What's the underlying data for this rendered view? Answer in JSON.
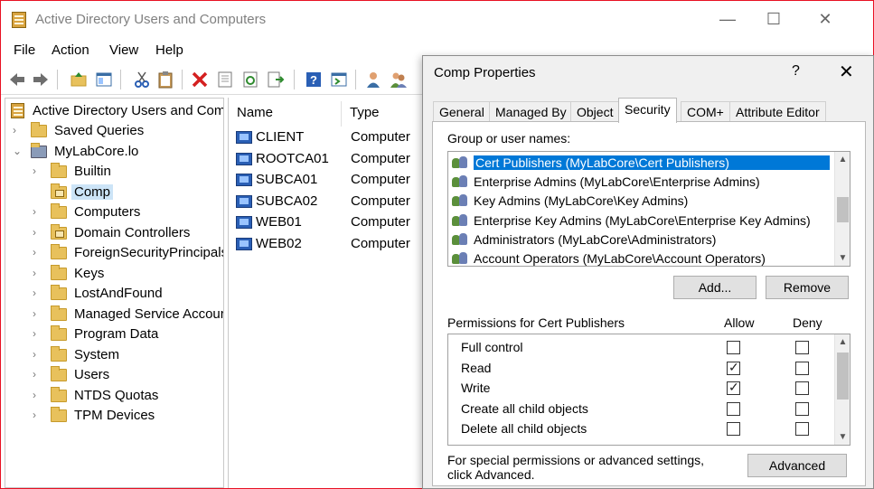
{
  "window": {
    "title": "Active Directory Users and Computers",
    "minimize": "—",
    "maximize": "☐",
    "close": "✕"
  },
  "menu": [
    "File",
    "Action",
    "View",
    "Help"
  ],
  "toolbar": {
    "icons": [
      "back-arrow-icon",
      "forward-arrow-icon",
      "up-folder-icon",
      "show-hide-tree-icon",
      "cut-icon",
      "clipboard-icon",
      "delete-icon",
      "properties-icon",
      "refresh-icon",
      "export-list-icon",
      "help-icon",
      "console-icon",
      "user-icon",
      "users-icon"
    ]
  },
  "tree": {
    "root": "Active Directory Users and Com",
    "items": [
      {
        "label": "Saved Queries",
        "level": 1,
        "expander": "›"
      },
      {
        "label": "MyLabCore.lo",
        "level": 1,
        "expander": "⌄"
      },
      {
        "label": "Builtin",
        "level": 2,
        "expander": "›"
      },
      {
        "label": "Comp",
        "level": 2,
        "expander": "",
        "selected": true
      },
      {
        "label": "Computers",
        "level": 2,
        "expander": "›"
      },
      {
        "label": "Domain Controllers",
        "level": 2,
        "expander": "›"
      },
      {
        "label": "ForeignSecurityPrincipals",
        "level": 2,
        "expander": "›"
      },
      {
        "label": "Keys",
        "level": 2,
        "expander": "›"
      },
      {
        "label": "LostAndFound",
        "level": 2,
        "expander": "›"
      },
      {
        "label": "Managed Service Accour",
        "level": 2,
        "expander": "›"
      },
      {
        "label": "Program Data",
        "level": 2,
        "expander": "›"
      },
      {
        "label": "System",
        "level": 2,
        "expander": "›"
      },
      {
        "label": "Users",
        "level": 2,
        "expander": "›"
      },
      {
        "label": "NTDS Quotas",
        "level": 2,
        "expander": "›"
      },
      {
        "label": "TPM Devices",
        "level": 2,
        "expander": "›"
      }
    ]
  },
  "list": {
    "columns": [
      "Name",
      "Type"
    ],
    "rows": [
      {
        "name": "CLIENT",
        "type": "Computer"
      },
      {
        "name": "ROOTCA01",
        "type": "Computer"
      },
      {
        "name": "SUBCA01",
        "type": "Computer"
      },
      {
        "name": "SUBCA02",
        "type": "Computer"
      },
      {
        "name": "WEB01",
        "type": "Computer"
      },
      {
        "name": "WEB02",
        "type": "Computer"
      }
    ]
  },
  "dialog": {
    "title": "Comp Properties",
    "help": "?",
    "close": "✕",
    "tabs": [
      "General",
      "Managed By",
      "Object",
      "Security",
      "COM+",
      "Attribute Editor"
    ],
    "active_tab": "Security",
    "group_label": "Group or user names:",
    "groups": [
      "Cert Publishers (MyLabCore\\Cert Publishers)",
      "Enterprise Admins (MyLabCore\\Enterprise Admins)",
      "Key Admins (MyLabCore\\Key Admins)",
      "Enterprise Key Admins (MyLabCore\\Enterprise Key Admins)",
      "Administrators (MyLabCore\\Administrators)",
      "Account Operators (MyLabCore\\Account Operators)"
    ],
    "add_button": "Add...",
    "remove_button": "Remove",
    "permissions_label": "Permissions for Cert Publishers",
    "allow_label": "Allow",
    "deny_label": "Deny",
    "permissions": [
      {
        "name": "Full control",
        "allow": false,
        "deny": false
      },
      {
        "name": "Read",
        "allow": true,
        "deny": false
      },
      {
        "name": "Write",
        "allow": true,
        "deny": false
      },
      {
        "name": "Create all child objects",
        "allow": false,
        "deny": false
      },
      {
        "name": "Delete all child objects",
        "allow": false,
        "deny": false
      }
    ],
    "special_text": "For special permissions or advanced settings, click Advanced.",
    "advanced_button": "Advanced"
  },
  "colors": {
    "selection": "#0078d7",
    "tree_selection": "#cce4f7",
    "frame_border": "#e81123"
  }
}
